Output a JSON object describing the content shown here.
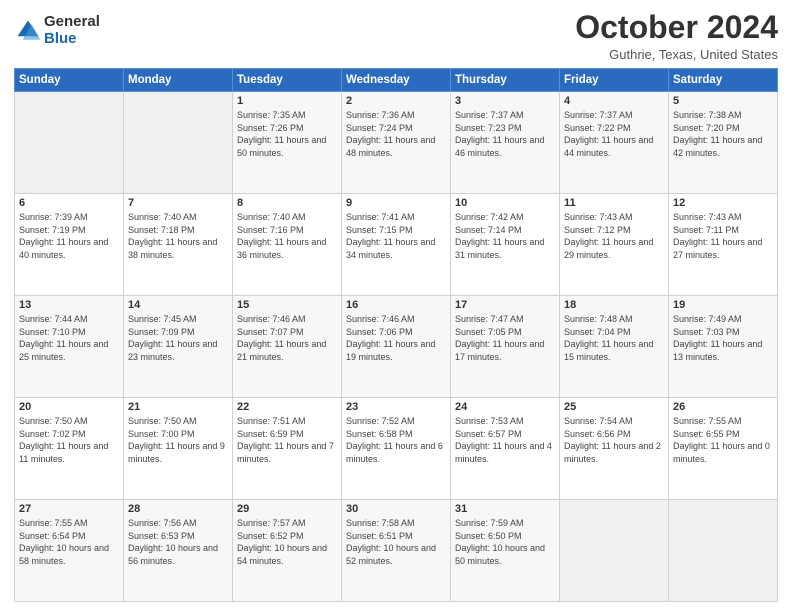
{
  "header": {
    "logo": {
      "general": "General",
      "blue": "Blue"
    },
    "title": "October 2024",
    "location": "Guthrie, Texas, United States"
  },
  "days_of_week": [
    "Sunday",
    "Monday",
    "Tuesday",
    "Wednesday",
    "Thursday",
    "Friday",
    "Saturday"
  ],
  "weeks": [
    [
      {
        "day": "",
        "sunrise": "",
        "sunset": "",
        "daylight": ""
      },
      {
        "day": "",
        "sunrise": "",
        "sunset": "",
        "daylight": ""
      },
      {
        "day": "1",
        "sunrise": "Sunrise: 7:35 AM",
        "sunset": "Sunset: 7:26 PM",
        "daylight": "Daylight: 11 hours and 50 minutes."
      },
      {
        "day": "2",
        "sunrise": "Sunrise: 7:36 AM",
        "sunset": "Sunset: 7:24 PM",
        "daylight": "Daylight: 11 hours and 48 minutes."
      },
      {
        "day": "3",
        "sunrise": "Sunrise: 7:37 AM",
        "sunset": "Sunset: 7:23 PM",
        "daylight": "Daylight: 11 hours and 46 minutes."
      },
      {
        "day": "4",
        "sunrise": "Sunrise: 7:37 AM",
        "sunset": "Sunset: 7:22 PM",
        "daylight": "Daylight: 11 hours and 44 minutes."
      },
      {
        "day": "5",
        "sunrise": "Sunrise: 7:38 AM",
        "sunset": "Sunset: 7:20 PM",
        "daylight": "Daylight: 11 hours and 42 minutes."
      }
    ],
    [
      {
        "day": "6",
        "sunrise": "Sunrise: 7:39 AM",
        "sunset": "Sunset: 7:19 PM",
        "daylight": "Daylight: 11 hours and 40 minutes."
      },
      {
        "day": "7",
        "sunrise": "Sunrise: 7:40 AM",
        "sunset": "Sunset: 7:18 PM",
        "daylight": "Daylight: 11 hours and 38 minutes."
      },
      {
        "day": "8",
        "sunrise": "Sunrise: 7:40 AM",
        "sunset": "Sunset: 7:16 PM",
        "daylight": "Daylight: 11 hours and 36 minutes."
      },
      {
        "day": "9",
        "sunrise": "Sunrise: 7:41 AM",
        "sunset": "Sunset: 7:15 PM",
        "daylight": "Daylight: 11 hours and 34 minutes."
      },
      {
        "day": "10",
        "sunrise": "Sunrise: 7:42 AM",
        "sunset": "Sunset: 7:14 PM",
        "daylight": "Daylight: 11 hours and 31 minutes."
      },
      {
        "day": "11",
        "sunrise": "Sunrise: 7:43 AM",
        "sunset": "Sunset: 7:12 PM",
        "daylight": "Daylight: 11 hours and 29 minutes."
      },
      {
        "day": "12",
        "sunrise": "Sunrise: 7:43 AM",
        "sunset": "Sunset: 7:11 PM",
        "daylight": "Daylight: 11 hours and 27 minutes."
      }
    ],
    [
      {
        "day": "13",
        "sunrise": "Sunrise: 7:44 AM",
        "sunset": "Sunset: 7:10 PM",
        "daylight": "Daylight: 11 hours and 25 minutes."
      },
      {
        "day": "14",
        "sunrise": "Sunrise: 7:45 AM",
        "sunset": "Sunset: 7:09 PM",
        "daylight": "Daylight: 11 hours and 23 minutes."
      },
      {
        "day": "15",
        "sunrise": "Sunrise: 7:46 AM",
        "sunset": "Sunset: 7:07 PM",
        "daylight": "Daylight: 11 hours and 21 minutes."
      },
      {
        "day": "16",
        "sunrise": "Sunrise: 7:46 AM",
        "sunset": "Sunset: 7:06 PM",
        "daylight": "Daylight: 11 hours and 19 minutes."
      },
      {
        "day": "17",
        "sunrise": "Sunrise: 7:47 AM",
        "sunset": "Sunset: 7:05 PM",
        "daylight": "Daylight: 11 hours and 17 minutes."
      },
      {
        "day": "18",
        "sunrise": "Sunrise: 7:48 AM",
        "sunset": "Sunset: 7:04 PM",
        "daylight": "Daylight: 11 hours and 15 minutes."
      },
      {
        "day": "19",
        "sunrise": "Sunrise: 7:49 AM",
        "sunset": "Sunset: 7:03 PM",
        "daylight": "Daylight: 11 hours and 13 minutes."
      }
    ],
    [
      {
        "day": "20",
        "sunrise": "Sunrise: 7:50 AM",
        "sunset": "Sunset: 7:02 PM",
        "daylight": "Daylight: 11 hours and 11 minutes."
      },
      {
        "day": "21",
        "sunrise": "Sunrise: 7:50 AM",
        "sunset": "Sunset: 7:00 PM",
        "daylight": "Daylight: 11 hours and 9 minutes."
      },
      {
        "day": "22",
        "sunrise": "Sunrise: 7:51 AM",
        "sunset": "Sunset: 6:59 PM",
        "daylight": "Daylight: 11 hours and 7 minutes."
      },
      {
        "day": "23",
        "sunrise": "Sunrise: 7:52 AM",
        "sunset": "Sunset: 6:58 PM",
        "daylight": "Daylight: 11 hours and 6 minutes."
      },
      {
        "day": "24",
        "sunrise": "Sunrise: 7:53 AM",
        "sunset": "Sunset: 6:57 PM",
        "daylight": "Daylight: 11 hours and 4 minutes."
      },
      {
        "day": "25",
        "sunrise": "Sunrise: 7:54 AM",
        "sunset": "Sunset: 6:56 PM",
        "daylight": "Daylight: 11 hours and 2 minutes."
      },
      {
        "day": "26",
        "sunrise": "Sunrise: 7:55 AM",
        "sunset": "Sunset: 6:55 PM",
        "daylight": "Daylight: 11 hours and 0 minutes."
      }
    ],
    [
      {
        "day": "27",
        "sunrise": "Sunrise: 7:55 AM",
        "sunset": "Sunset: 6:54 PM",
        "daylight": "Daylight: 10 hours and 58 minutes."
      },
      {
        "day": "28",
        "sunrise": "Sunrise: 7:56 AM",
        "sunset": "Sunset: 6:53 PM",
        "daylight": "Daylight: 10 hours and 56 minutes."
      },
      {
        "day": "29",
        "sunrise": "Sunrise: 7:57 AM",
        "sunset": "Sunset: 6:52 PM",
        "daylight": "Daylight: 10 hours and 54 minutes."
      },
      {
        "day": "30",
        "sunrise": "Sunrise: 7:58 AM",
        "sunset": "Sunset: 6:51 PM",
        "daylight": "Daylight: 10 hours and 52 minutes."
      },
      {
        "day": "31",
        "sunrise": "Sunrise: 7:59 AM",
        "sunset": "Sunset: 6:50 PM",
        "daylight": "Daylight: 10 hours and 50 minutes."
      },
      {
        "day": "",
        "sunrise": "",
        "sunset": "",
        "daylight": ""
      },
      {
        "day": "",
        "sunrise": "",
        "sunset": "",
        "daylight": ""
      }
    ]
  ]
}
